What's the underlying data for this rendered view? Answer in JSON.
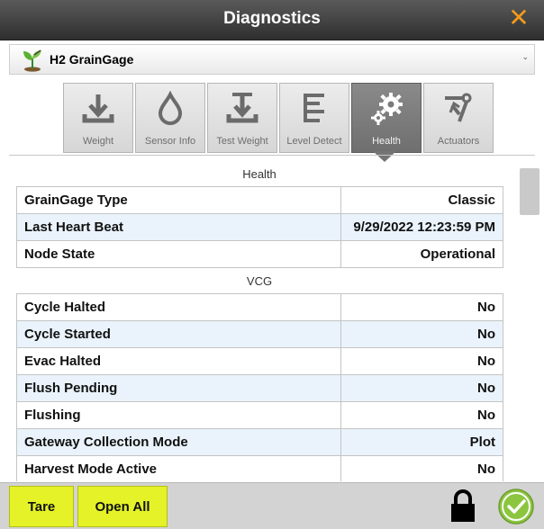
{
  "window": {
    "title": "Diagnostics"
  },
  "device": {
    "name": "H2 GrainGage"
  },
  "tabs": [
    {
      "label": "Weight",
      "icon": "download-arrow-icon",
      "active": false
    },
    {
      "label": "Sensor Info",
      "icon": "water-drop-icon",
      "active": false
    },
    {
      "label": "Test Weight",
      "icon": "test-weight-icon",
      "active": false
    },
    {
      "label": "Level Detect",
      "icon": "level-bars-icon",
      "active": false
    },
    {
      "label": "Health",
      "icon": "gears-icon",
      "active": true
    },
    {
      "label": "Actuators",
      "icon": "actuator-arm-icon",
      "active": false
    }
  ],
  "health": {
    "title": "Health",
    "rows": [
      {
        "label": "GrainGage Type",
        "value": "Classic"
      },
      {
        "label": "Last Heart Beat",
        "value": "9/29/2022 12:23:59 PM"
      },
      {
        "label": "Node State",
        "value": "Operational"
      }
    ]
  },
  "vcg": {
    "title": "VCG",
    "rows": [
      {
        "label": "Cycle Halted",
        "value": "No"
      },
      {
        "label": "Cycle Started",
        "value": "No"
      },
      {
        "label": "Evac Halted",
        "value": "No"
      },
      {
        "label": "Flush Pending",
        "value": "No"
      },
      {
        "label": "Flushing",
        "value": "No"
      },
      {
        "label": "Gateway Collection Mode",
        "value": "Plot"
      },
      {
        "label": "Harvest Mode Active",
        "value": "No"
      }
    ]
  },
  "footer": {
    "tare_label": "Tare",
    "open_all_label": "Open All"
  },
  "colors": {
    "accent_yellow": "#e4f227",
    "close_orange": "#f39a1b",
    "confirm_green": "#8cc63f",
    "row_alt": "#eaf3fb"
  }
}
